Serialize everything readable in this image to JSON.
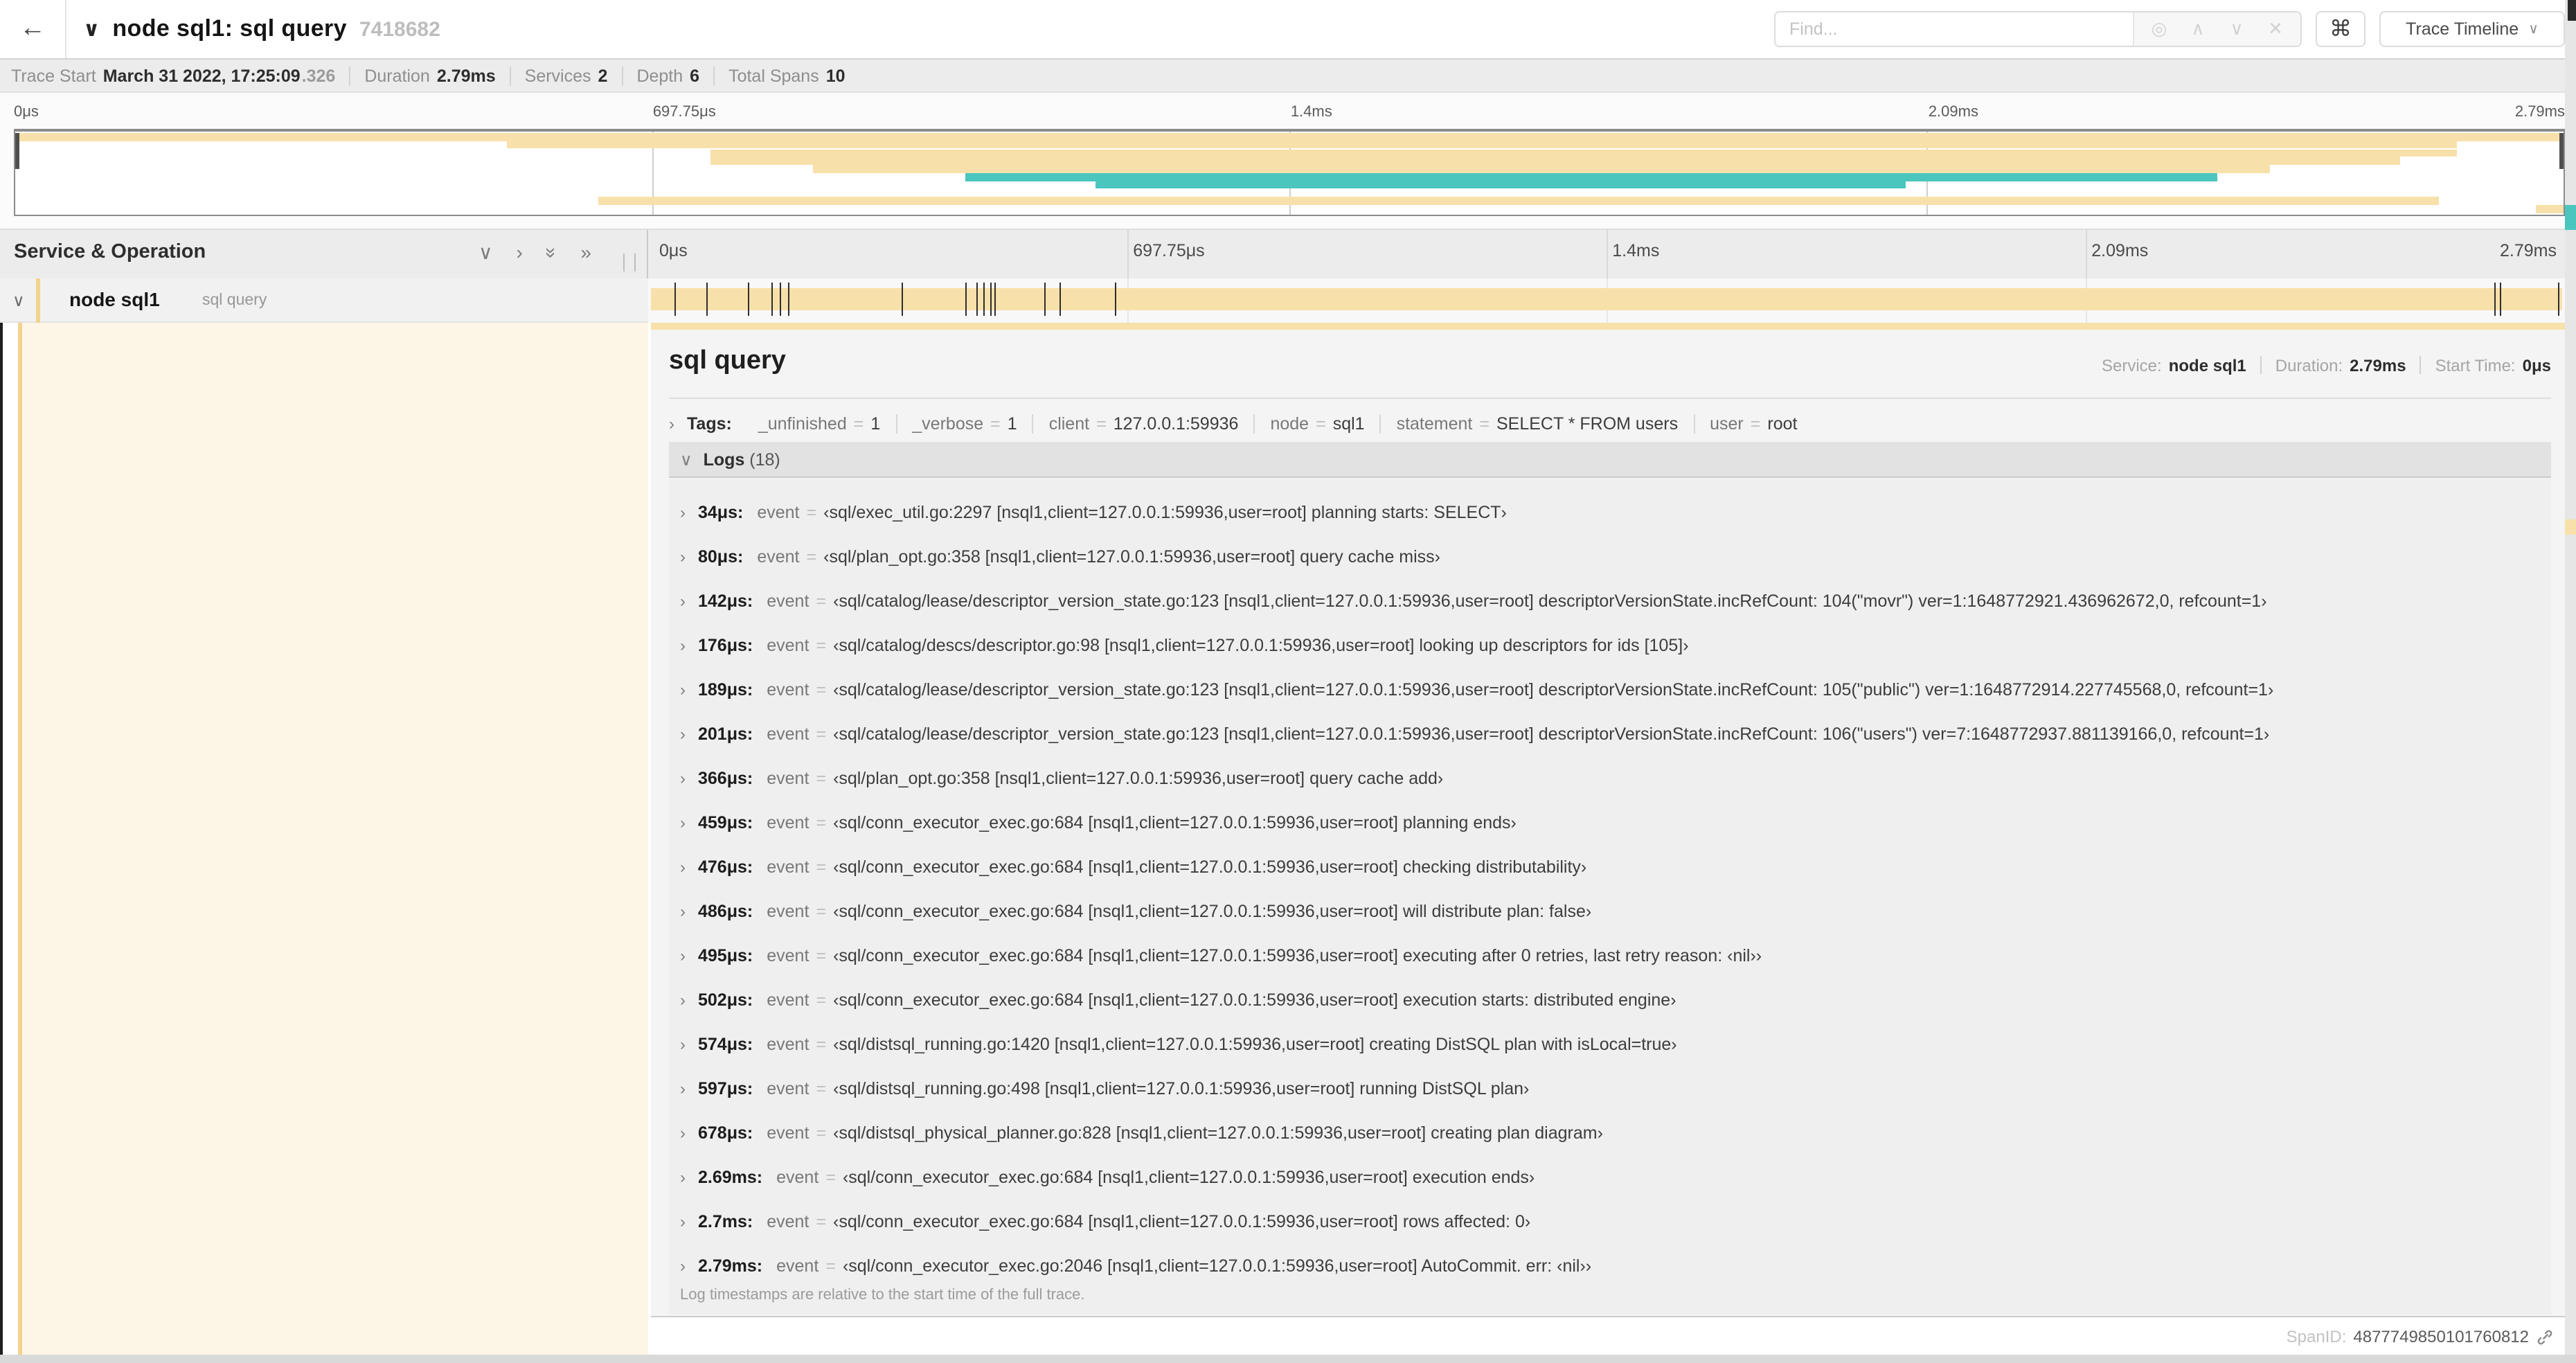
{
  "colors": {
    "tan": "#f8e0aa",
    "tan_dark": "#f2d38e",
    "teal": "#4ac6bf",
    "cream": "#fdf6e6"
  },
  "header": {
    "back_icon": "←",
    "collapse_icon": "∨",
    "title": "node sql1: sql query",
    "trace_id": "7418682",
    "find_placeholder": "Find...",
    "focus_icon": "◎",
    "prev_icon": "∧",
    "next_icon": "∨",
    "clear_icon": "✕",
    "shortcuts_icon": "⌘",
    "view_button": "Trace Timeline",
    "view_chevron": "∨"
  },
  "summary": {
    "trace_start_label": "Trace Start",
    "trace_start_value": "March 31 2022, 17:25:09",
    "trace_start_frac": ".326",
    "duration_label": "Duration",
    "duration_value": "2.79ms",
    "services_label": "Services",
    "services_value": "2",
    "depth_label": "Depth",
    "depth_value": "6",
    "total_spans_label": "Total Spans",
    "total_spans_value": "10"
  },
  "minimap": {
    "ticks": [
      "0μs",
      "697.75μs",
      "1.4ms",
      "2.09ms",
      "2.79ms"
    ],
    "bars": [
      {
        "l": 0,
        "r": 100,
        "c": "tan"
      },
      {
        "l": 19.3,
        "r": 95.8,
        "c": "tan"
      },
      {
        "l": 27.3,
        "r": 95.8,
        "c": "tan"
      },
      {
        "l": 27.3,
        "r": 93.6,
        "c": "tan"
      },
      {
        "l": 31.3,
        "r": 88.5,
        "c": "tan"
      },
      {
        "l": 37.3,
        "r": 86.4,
        "c": "teal"
      },
      {
        "l": 42.4,
        "r": 74.2,
        "c": "teal"
      },
      {
        "l": 0,
        "r": 0,
        "c": "none"
      },
      {
        "l": 22.9,
        "r": 95.1,
        "c": "tan"
      },
      {
        "l": 98.9,
        "r": 100,
        "c": "tan"
      }
    ]
  },
  "timeline": {
    "header": "Service & Operation",
    "collapse_one_icon": "∨",
    "expand_one_icon": "›",
    "collapse_all_icon": "»",
    "expand_all_icon": "»",
    "ticks": [
      "0μs",
      "697.75μs",
      "1.4ms",
      "2.09ms",
      "2.79ms"
    ],
    "total_us": 2790,
    "row": {
      "chevron": "∨",
      "service": "node sql1",
      "operation": "sql query"
    }
  },
  "detail": {
    "operation": "sql query",
    "service_label": "Service:",
    "service": "node sql1",
    "duration_label": "Duration:",
    "duration": "2.79ms",
    "start_label": "Start Time:",
    "start": "0μs",
    "tags_label": "Tags:",
    "tags": [
      {
        "key": "_unfinished",
        "value": "1"
      },
      {
        "key": "_verbose",
        "value": "1"
      },
      {
        "key": "client",
        "value": "127.0.0.1:59936"
      },
      {
        "key": "node",
        "value": "sql1"
      },
      {
        "key": "statement",
        "value": "SELECT * FROM users"
      },
      {
        "key": "user",
        "value": "root"
      }
    ],
    "logs_label": "Logs",
    "logs_count": "(18)",
    "logs": [
      {
        "label": "34μs:",
        "t_us": 34,
        "field": "event",
        "value": "‹sql/exec_util.go:2297 [nsql1,client=127.0.0.1:59936,user=root] planning starts: SELECT›"
      },
      {
        "label": "80μs:",
        "t_us": 80,
        "field": "event",
        "value": "‹sql/plan_opt.go:358 [nsql1,client=127.0.0.1:59936,user=root] query cache miss›"
      },
      {
        "label": "142μs:",
        "t_us": 142,
        "field": "event",
        "value": "‹sql/catalog/lease/descriptor_version_state.go:123 [nsql1,client=127.0.0.1:59936,user=root] descriptorVersionState.incRefCount: 104(\"movr\") ver=1:1648772921.436962672,0, refcount=1›"
      },
      {
        "label": "176μs:",
        "t_us": 176,
        "field": "event",
        "value": "‹sql/catalog/descs/descriptor.go:98 [nsql1,client=127.0.0.1:59936,user=root] looking up descriptors for ids [105]›"
      },
      {
        "label": "189μs:",
        "t_us": 189,
        "field": "event",
        "value": "‹sql/catalog/lease/descriptor_version_state.go:123 [nsql1,client=127.0.0.1:59936,user=root] descriptorVersionState.incRefCount: 105(\"public\") ver=1:1648772914.227745568,0, refcount=1›"
      },
      {
        "label": "201μs:",
        "t_us": 201,
        "field": "event",
        "value": "‹sql/catalog/lease/descriptor_version_state.go:123 [nsql1,client=127.0.0.1:59936,user=root] descriptorVersionState.incRefCount: 106(\"users\") ver=7:1648772937.881139166,0, refcount=1›"
      },
      {
        "label": "366μs:",
        "t_us": 366,
        "field": "event",
        "value": "‹sql/plan_opt.go:358 [nsql1,client=127.0.0.1:59936,user=root] query cache add›"
      },
      {
        "label": "459μs:",
        "t_us": 459,
        "field": "event",
        "value": "‹sql/conn_executor_exec.go:684 [nsql1,client=127.0.0.1:59936,user=root] planning ends›"
      },
      {
        "label": "476μs:",
        "t_us": 476,
        "field": "event",
        "value": "‹sql/conn_executor_exec.go:684 [nsql1,client=127.0.0.1:59936,user=root] checking distributability›"
      },
      {
        "label": "486μs:",
        "t_us": 486,
        "field": "event",
        "value": "‹sql/conn_executor_exec.go:684 [nsql1,client=127.0.0.1:59936,user=root] will distribute plan: false›"
      },
      {
        "label": "495μs:",
        "t_us": 495,
        "field": "event",
        "value": "‹sql/conn_executor_exec.go:684 [nsql1,client=127.0.0.1:59936,user=root] executing after 0 retries, last retry reason: ‹nil››"
      },
      {
        "label": "502μs:",
        "t_us": 502,
        "field": "event",
        "value": "‹sql/conn_executor_exec.go:684 [nsql1,client=127.0.0.1:59936,user=root] execution starts: distributed engine›"
      },
      {
        "label": "574μs:",
        "t_us": 574,
        "field": "event",
        "value": "‹sql/distsql_running.go:1420 [nsql1,client=127.0.0.1:59936,user=root] creating DistSQL plan with isLocal=true›"
      },
      {
        "label": "597μs:",
        "t_us": 597,
        "field": "event",
        "value": "‹sql/distsql_running.go:498 [nsql1,client=127.0.0.1:59936,user=root] running DistSQL plan›"
      },
      {
        "label": "678μs:",
        "t_us": 678,
        "field": "event",
        "value": "‹sql/distsql_physical_planner.go:828 [nsql1,client=127.0.0.1:59936,user=root] creating plan diagram›"
      },
      {
        "label": "2.69ms:",
        "t_us": 2690,
        "field": "event",
        "value": "‹sql/conn_executor_exec.go:684 [nsql1,client=127.0.0.1:59936,user=root] execution ends›"
      },
      {
        "label": "2.7ms:",
        "t_us": 2700,
        "field": "event",
        "value": "‹sql/conn_executor_exec.go:684 [nsql1,client=127.0.0.1:59936,user=root] rows affected: 0›"
      },
      {
        "label": "2.79ms:",
        "t_us": 2790,
        "field": "event",
        "value": "‹sql/conn_executor_exec.go:2046 [nsql1,client=127.0.0.1:59936,user=root] AutoCommit. err: ‹nil››"
      }
    ],
    "footnote": "Log timestamps are relative to the start time of the full trace.",
    "spanid_label": "SpanID:",
    "spanid_value": "4877749850101760812"
  }
}
